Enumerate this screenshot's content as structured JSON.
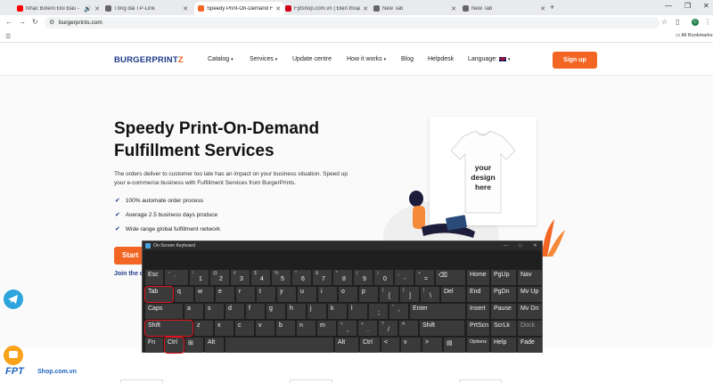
{
  "browser": {
    "tabs": [
      {
        "title": "Nhạc Bolero Đối Đầu - Những",
        "favicon_color": "#ff0000",
        "has_audio": true
      },
      {
        "title": "Tổng đài TP-Link",
        "favicon_color": "#666666"
      },
      {
        "title": "Speedy Print-On-Demand Fulfil",
        "favicon_color": "#f26522",
        "active": true
      },
      {
        "title": "Fptshop.com.vn | Điện thoại, Lap",
        "favicon_color": "#d0021b"
      },
      {
        "title": "New Tab",
        "favicon_color": "#666666"
      },
      {
        "title": "New Tab",
        "favicon_color": "#666666"
      }
    ],
    "url": "burgerprints.com",
    "profile_initial": "C",
    "all_bookmarks": "All Bookmarks"
  },
  "site": {
    "logo_main": "BURGERPRINT",
    "logo_accent": "Z",
    "nav": [
      {
        "label": "Catalog",
        "dropdown": true
      },
      {
        "label": "Services",
        "dropdown": true
      },
      {
        "label": "Update centre",
        "dropdown": false
      },
      {
        "label": "How it works",
        "dropdown": true
      },
      {
        "label": "Blog",
        "dropdown": false
      },
      {
        "label": "Helpdesk",
        "dropdown": false
      },
      {
        "label": "Language:",
        "dropdown": true
      }
    ],
    "signup_label": "Sign up",
    "hero": {
      "title_line1": "Speedy Print-On-Demand",
      "title_line2": "Fulfillment Services",
      "description": "The orders deliver to customer too late has an impact on your business situation. Speed up your e-commerce business with Fulfillment Services from BurgerPrints.",
      "features": [
        "100% automate order process",
        "Average 2.5 business days produce",
        "Wide range global fulfillment network"
      ],
      "start_label": "Start",
      "join_label": "Join the c",
      "tshirt_text": "your design here"
    },
    "fpt_logo": "FPT",
    "fpt_shop": "Shop.com.vn"
  },
  "keyboard": {
    "title": "On-Screen Keyboard",
    "rows": [
      [
        {
          "label": "Esc"
        },
        {
          "sub": "~",
          "label": "`"
        },
        {
          "sub": "!",
          "label": "1"
        },
        {
          "sub": "@",
          "label": "2"
        },
        {
          "sub": "#",
          "label": "3"
        },
        {
          "sub": "$",
          "label": "4"
        },
        {
          "sub": "%",
          "label": "5"
        },
        {
          "sub": "^",
          "label": "6"
        },
        {
          "sub": "&",
          "label": "7"
        },
        {
          "sub": "*",
          "label": "8"
        },
        {
          "sub": "(",
          "label": "9"
        },
        {
          "sub": ")",
          "label": "0"
        },
        {
          "sub": "_",
          "label": "-"
        },
        {
          "sub": "+",
          "label": "="
        },
        {
          "label": "⌫"
        },
        {
          "label": "Home"
        },
        {
          "label": "PgUp"
        },
        {
          "label": "Nav"
        }
      ],
      [
        {
          "label": "Tab",
          "highlighted": true
        },
        {
          "label": "q"
        },
        {
          "label": "w"
        },
        {
          "label": "e"
        },
        {
          "label": "r"
        },
        {
          "label": "t"
        },
        {
          "label": "y"
        },
        {
          "label": "u"
        },
        {
          "label": "i"
        },
        {
          "label": "o"
        },
        {
          "label": "p"
        },
        {
          "sub": "{",
          "label": "["
        },
        {
          "sub": "}",
          "label": "]"
        },
        {
          "sub": "|",
          "label": "\\"
        },
        {
          "label": "Del"
        },
        {
          "label": "End"
        },
        {
          "label": "PgDn"
        },
        {
          "label": "Mv Up"
        }
      ],
      [
        {
          "label": "Caps"
        },
        {
          "label": "a"
        },
        {
          "label": "s"
        },
        {
          "label": "d"
        },
        {
          "label": "f"
        },
        {
          "label": "g"
        },
        {
          "label": "h"
        },
        {
          "label": "j"
        },
        {
          "label": "k"
        },
        {
          "label": "l"
        },
        {
          "sub": ":",
          "label": ";"
        },
        {
          "sub": "\"",
          "label": "'"
        },
        {
          "label": "Enter"
        },
        {
          "label": "Insert"
        },
        {
          "label": "Pause"
        },
        {
          "label": "Mv Dn"
        }
      ],
      [
        {
          "label": "Shift",
          "highlighted": true
        },
        {
          "label": "z"
        },
        {
          "label": "x"
        },
        {
          "label": "c"
        },
        {
          "label": "v"
        },
        {
          "label": "b"
        },
        {
          "label": "n"
        },
        {
          "label": "m"
        },
        {
          "sub": "<",
          "label": ","
        },
        {
          "sub": ">",
          "label": "."
        },
        {
          "sub": "?",
          "label": "/"
        },
        {
          "label": "^"
        },
        {
          "label": "Shift"
        },
        {
          "label": "PrtScn"
        },
        {
          "label": "ScrLk"
        },
        {
          "label": "Dock",
          "dim": true
        }
      ],
      [
        {
          "label": "Fn"
        },
        {
          "label": "Ctrl",
          "highlighted": true
        },
        {
          "label": "⊞"
        },
        {
          "label": "Alt"
        },
        {
          "label": ""
        },
        {
          "label": "Alt"
        },
        {
          "label": "Ctrl"
        },
        {
          "label": "<"
        },
        {
          "label": "v"
        },
        {
          "label": ">"
        },
        {
          "label": "▤"
        },
        {
          "label": "Options"
        },
        {
          "label": "Help"
        },
        {
          "label": "Fade"
        }
      ]
    ]
  }
}
